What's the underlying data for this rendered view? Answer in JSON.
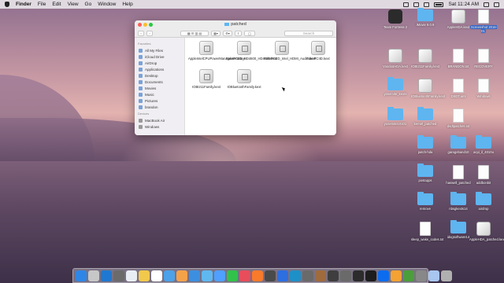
{
  "menubar": {
    "app_name": "Finder",
    "menus": [
      "File",
      "Edit",
      "View",
      "Go",
      "Window",
      "Help"
    ],
    "datetime": "Sat 11:24 AM"
  },
  "finder": {
    "window_title": "patched",
    "search_placeholder": "Search",
    "sidebar": {
      "favorites_header": "Favorites",
      "favorites": [
        "All My Files",
        "iCloud Drive",
        "AirDrop",
        "Applications",
        "Desktop",
        "Documents",
        "Movies",
        "Music",
        "Pictures",
        "brandon"
      ],
      "devices_header": "Devices",
      "devices": [
        "MacBook Air",
        "Windows"
      ]
    },
    "files": [
      "AppleIntelCPUPowerManagement.kext",
      "FakePCIID_HD4600_HD4400.kext",
      "FakePCIID_Intel_HDMI_Audio.kext",
      "FakePCIID.kext",
      "IOBI211Family.kext",
      "IOBluetoothFamily.kext"
    ]
  },
  "desktop": {
    "icons": [
      {
        "label": "Team Fortress 2",
        "kind": "app"
      },
      {
        "label": "iMovie 9.0.9",
        "kind": "folder"
      },
      {
        "label": "AppleHDA.kext",
        "kind": "kext"
      },
      {
        "label": "Screenshot 2016-01",
        "kind": "doc"
      },
      {
        "label": "VoodooHDA.kext",
        "kind": "kext"
      },
      {
        "label": "IOBI211Family.kext",
        "kind": "kext"
      },
      {
        "label": "BRANDON.txt",
        "kind": "doc"
      },
      {
        "label": "RECOVERY",
        "kind": "doc"
      },
      {
        "label": "yosemite_kexts",
        "kind": "folder"
      },
      {
        "label": "IOBluetoothFamily.kext",
        "kind": "kext"
      },
      {
        "label": "DSDT.aml",
        "kind": "doc"
      },
      {
        "label": "Windows",
        "kind": "doc"
      },
      {
        "label": "yosemite10101",
        "kind": "folder"
      },
      {
        "label": "kernel_patched",
        "kind": "folder"
      },
      {
        "label": "dsdtpatches.txt",
        "kind": "doc"
      },
      {
        "label": "patch-hda",
        "kind": "folder"
      },
      {
        "label": "garageband10",
        "kind": "folder"
      },
      {
        "label": "acpi_il_4010u",
        "kind": "folder"
      },
      {
        "label": "postapps",
        "kind": "folder"
      },
      {
        "label": "haswell_patched",
        "kind": "doc"
      },
      {
        "label": "addbonbit",
        "kind": "doc"
      },
      {
        "label": "remove",
        "kind": "folder"
      },
      {
        "label": "nbsgkexts14",
        "kind": "folder"
      },
      {
        "label": "airdrop",
        "kind": "folder"
      },
      {
        "label": "sleep_wake_codes.txt",
        "kind": "doc"
      },
      {
        "label": "idogsoftware14",
        "kind": "folder"
      },
      {
        "label": "AppleHDA_patched.kext",
        "kind": "kext"
      }
    ]
  },
  "dock": {
    "colors": [
      "#2f86e6",
      "#c7c7c7",
      "#1f78d1",
      "#6b6b6b",
      "#e9eef5",
      "#f2c94c",
      "#ffffff",
      "#4ca1e8",
      "#f4a24a",
      "#3c8fe0",
      "#5fb8f0",
      "#4fa0ff",
      "#31c24b",
      "#e84d5b",
      "#fa7a2b",
      "#4a4a4a",
      "#2d6ee0",
      "#1e90c8",
      "#6a6a6a",
      "#a06b3c",
      "#3e3e3e",
      "#6a6a6a",
      "#2c2c2c",
      "#1d1d1d",
      "#0b6cf0",
      "#f3a233",
      "#4b9e3a",
      "#888888",
      "#a8c6f0",
      "#b0b0b0"
    ]
  }
}
